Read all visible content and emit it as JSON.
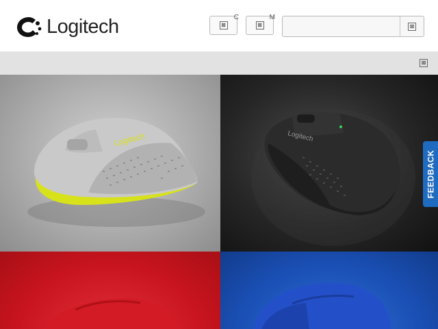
{
  "header": {
    "logo_text": "Logitech",
    "button_1_tag": "C",
    "button_2_tag": "M",
    "search": {
      "placeholder": "",
      "value": ""
    }
  },
  "tiles": [
    {
      "product": "gray-yellow-mouse",
      "brand_print": "Logitech"
    },
    {
      "product": "black-mouse",
      "brand_print": "Logitech"
    },
    {
      "product": "red-mouse",
      "brand_print": ""
    },
    {
      "product": "blue-mouse",
      "brand_print": ""
    }
  ],
  "feedback_label": "FEEDBACK",
  "icons": {
    "header_button_1": "broken-image-icon",
    "header_button_2": "broken-image-icon",
    "search_button": "broken-image-icon",
    "menu": "broken-image-icon"
  },
  "colors": {
    "feedback_tab": "#1f6bc0",
    "subbar": "#e2e2e2",
    "tile_gray": "#a9a9a9",
    "tile_black": "#262626",
    "tile_red": "#c8141e",
    "tile_blue": "#1a4fb4",
    "mouse_yellow": "#d7e21a"
  }
}
